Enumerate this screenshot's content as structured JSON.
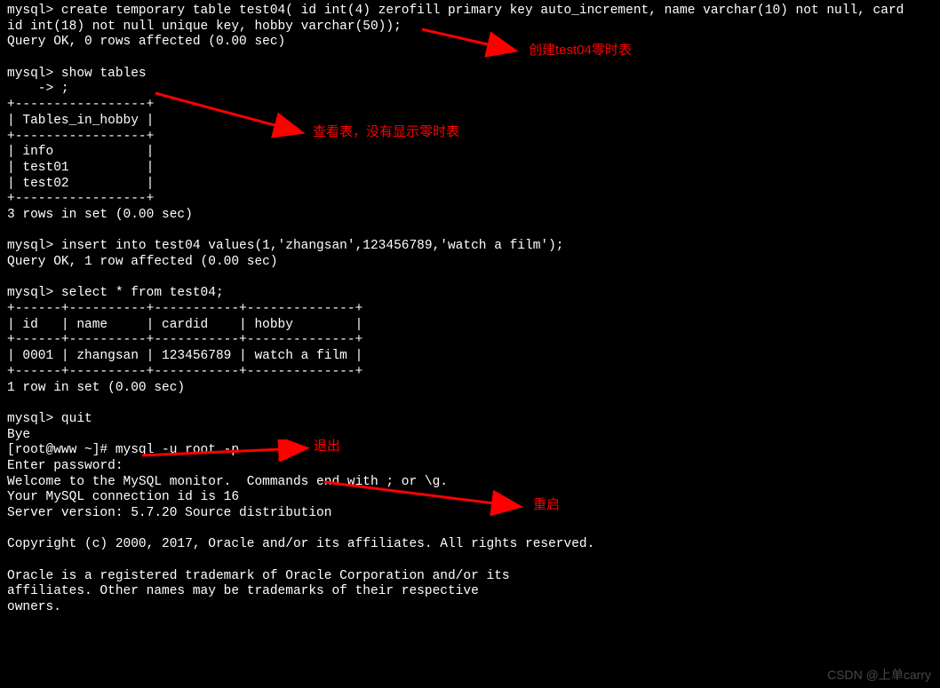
{
  "terminal": {
    "line01": "mysql> create temporary table test04( id int(4) zerofill primary key auto_increment, name varchar(10) not null, card",
    "line02": "id int(18) not null unique key, hobby varchar(50));",
    "line03": "Query OK, 0 rows affected (0.00 sec)",
    "line04": "",
    "line05": "mysql> show tables",
    "line06": "    -> ;",
    "line07": "+-----------------+",
    "line08": "| Tables_in_hobby |",
    "line09": "+-----------------+",
    "line10": "| info            |",
    "line11": "| test01          |",
    "line12": "| test02          |",
    "line13": "+-----------------+",
    "line14": "3 rows in set (0.00 sec)",
    "line15": "",
    "line16": "mysql> insert into test04 values(1,'zhangsan',123456789,'watch a film');",
    "line17": "Query OK, 1 row affected (0.00 sec)",
    "line18": "",
    "line19": "mysql> select * from test04;",
    "line20": "+------+----------+-----------+--------------+",
    "line21": "| id   | name     | cardid    | hobby        |",
    "line22": "+------+----------+-----------+--------------+",
    "line23": "| 0001 | zhangsan | 123456789 | watch a film |",
    "line24": "+------+----------+-----------+--------------+",
    "line25": "1 row in set (0.00 sec)",
    "line26": "",
    "line27": "mysql> quit",
    "line28": "Bye",
    "line29": "[root@www ~]# mysql -u root -p",
    "line30": "Enter password:",
    "line31": "Welcome to the MySQL monitor.  Commands end with ; or \\g.",
    "line32": "Your MySQL connection id is 16",
    "line33": "Server version: 5.7.20 Source distribution",
    "line34": "",
    "line35": "Copyright (c) 2000, 2017, Oracle and/or its affiliates. All rights reserved.",
    "line36": "",
    "line37": "Oracle is a registered trademark of Oracle Corporation and/or its",
    "line38": "affiliates. Other names may be trademarks of their respective",
    "line39": "owners."
  },
  "annotations": {
    "a1": "创建test04零时表",
    "a2": "查看表，没有显示零时表",
    "a3": "退出",
    "a4": "重启"
  },
  "watermark": "CSDN @上单carry"
}
